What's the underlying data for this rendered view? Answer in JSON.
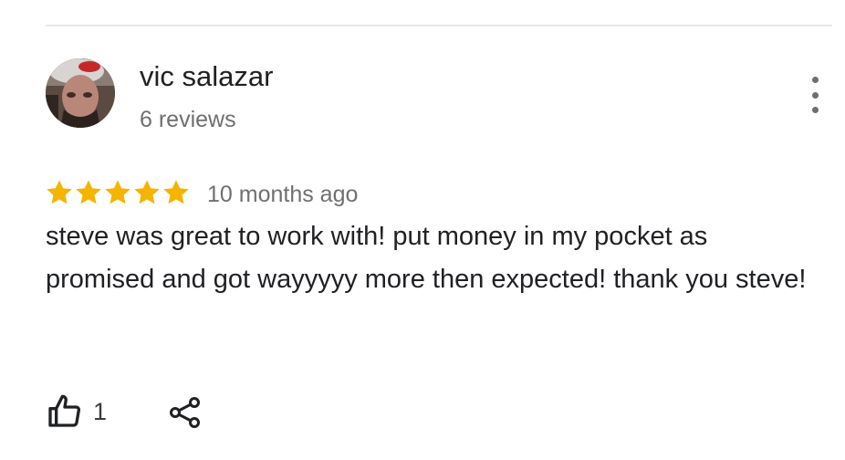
{
  "reviewer": {
    "name": "vic salazar",
    "review_count": "6 reviews",
    "avatar_icon": "user-avatar-photo"
  },
  "review": {
    "rating": 5,
    "rating_max": 5,
    "star_color": "#f4b400",
    "date": "10 months ago",
    "text": "steve was great to work with! put money in my pocket as promised and got wayyyyy more then expected! thank you steve!"
  },
  "actions": {
    "like_icon": "thumbs-up-icon",
    "like_count": "1",
    "share_icon": "share-icon",
    "more_icon": "more-vertical-icon"
  }
}
